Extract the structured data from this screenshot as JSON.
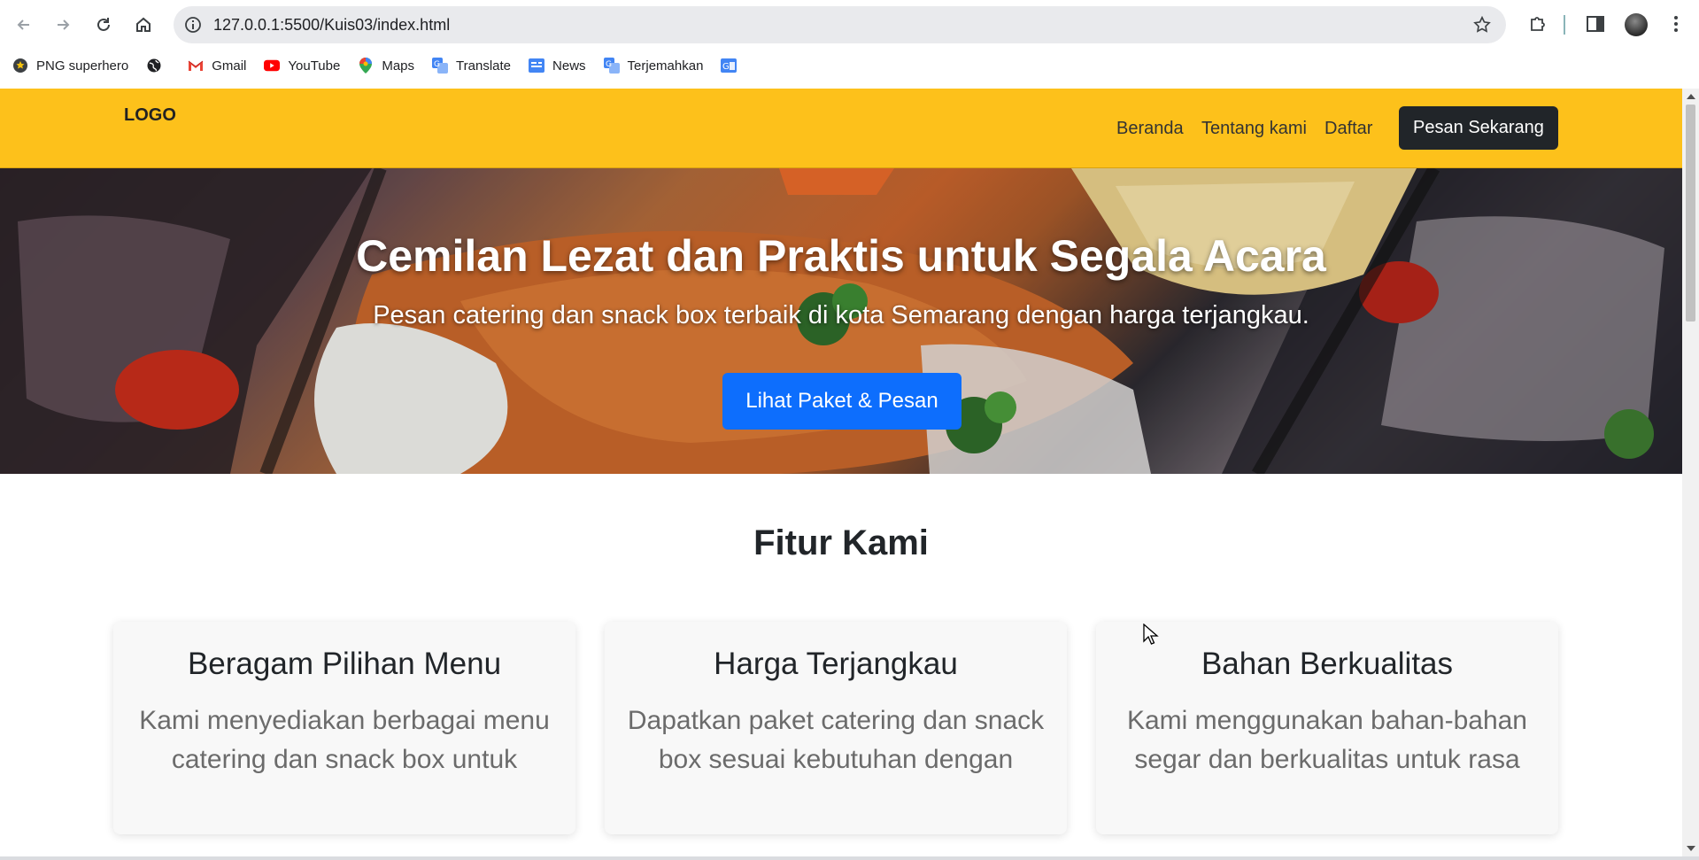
{
  "browser": {
    "url": "127.0.0.1:5500/Kuis03/index.html",
    "bookmarks": [
      {
        "label": "PNG superhero",
        "icon": "star-badge-icon"
      },
      {
        "label": "",
        "icon": "globe-icon"
      },
      {
        "label": "Gmail",
        "icon": "gmail-icon"
      },
      {
        "label": "YouTube",
        "icon": "youtube-icon"
      },
      {
        "label": "Maps",
        "icon": "maps-pin-icon"
      },
      {
        "label": "Translate",
        "icon": "translate-icon"
      },
      {
        "label": "News",
        "icon": "news-icon"
      },
      {
        "label": "Terjemahkan",
        "icon": "translate-icon"
      },
      {
        "label": "",
        "icon": "google-translate-icon"
      }
    ]
  },
  "site": {
    "logo": "LOGO",
    "nav": {
      "home": "Beranda",
      "about": "Tentang kami",
      "register": "Daftar",
      "cta": "Pesan Sekarang"
    },
    "hero": {
      "title": "Cemilan Lezat dan Praktis untuk Segala Acara",
      "subtitle": "Pesan catering dan snack box terbaik di kota Semarang dengan harga terjangkau.",
      "button": "Lihat Paket & Pesan"
    },
    "features": {
      "title": "Fitur Kami",
      "cards": [
        {
          "title": "Beragam Pilihan Menu",
          "text": "Kami menyediakan berbagai menu catering dan snack box untuk"
        },
        {
          "title": "Harga Terjangkau",
          "text": "Dapatkan paket catering dan snack box sesuai kebutuhan dengan"
        },
        {
          "title": "Bahan Berkualitas",
          "text": "Kami menggunakan bahan-bahan segar dan berkualitas untuk rasa"
        }
      ]
    }
  },
  "colors": {
    "header_bg": "#fdc11b",
    "cta_bg": "#212529",
    "hero_button_bg": "#0d6efd"
  }
}
